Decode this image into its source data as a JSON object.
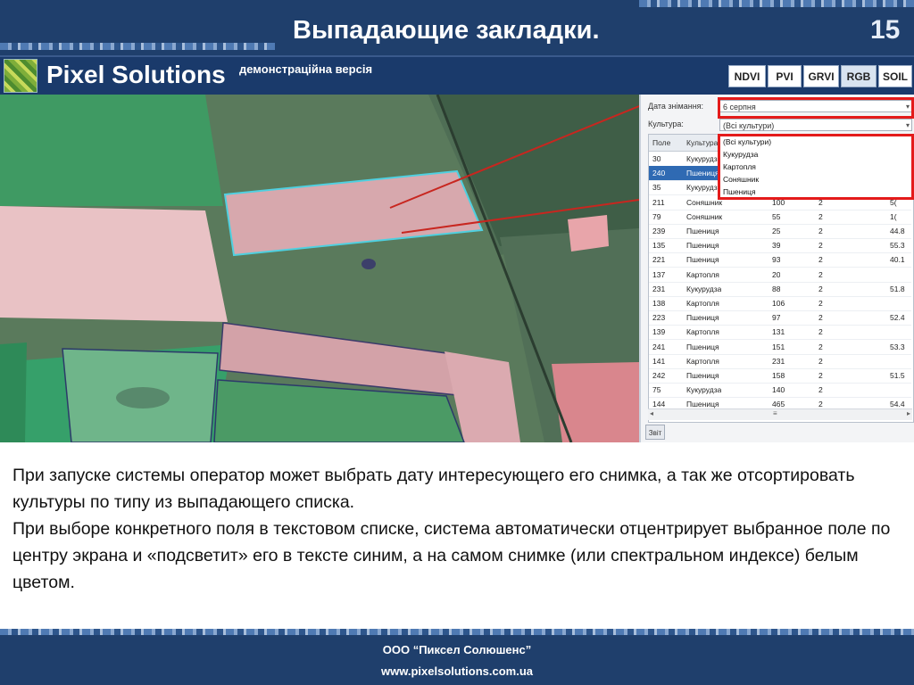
{
  "slide": {
    "title": "Выпадающие закладки.",
    "number": "15"
  },
  "app": {
    "name": "Pixel Solutions",
    "version": "демонстраційна версія",
    "tabs": [
      {
        "label": "NDVI",
        "active": false
      },
      {
        "label": "PVI",
        "active": false
      },
      {
        "label": "GRVI",
        "active": false
      },
      {
        "label": "RGB",
        "active": true
      },
      {
        "label": "SOIL",
        "active": false
      }
    ]
  },
  "panel": {
    "date_label": "Дата знімання:",
    "date_value": "6 серпня",
    "culture_label": "Культура:",
    "culture_value": "(Всі культури)",
    "columns": [
      "Поле",
      "Культура"
    ],
    "dropdown_options": [
      "(Всі культури)",
      "Кукурудза",
      "Картопля",
      "Соняшник",
      "Пшениця"
    ],
    "rows": [
      {
        "field": "30",
        "crop": "Кукурудза",
        "area": "",
        "n": "",
        "v": ""
      },
      {
        "field": "240",
        "crop": "Пшениця",
        "area": "",
        "n": "",
        "v": "",
        "selected": true
      },
      {
        "field": "35",
        "crop": "Кукурудза",
        "area": "",
        "n": "",
        "v": ""
      },
      {
        "field": "211",
        "crop": "Соняшник",
        "area": "100",
        "n": "2",
        "v": "5("
      },
      {
        "field": "79",
        "crop": "Соняшник",
        "area": "55",
        "n": "2",
        "v": "1("
      },
      {
        "field": "239",
        "crop": "Пшениця",
        "area": "25",
        "n": "2",
        "v": "44.8"
      },
      {
        "field": "135",
        "crop": "Пшениця",
        "area": "39",
        "n": "2",
        "v": "55.3"
      },
      {
        "field": "221",
        "crop": "Пшениця",
        "area": "93",
        "n": "2",
        "v": "40.1"
      },
      {
        "field": "137",
        "crop": "Картопля",
        "area": "20",
        "n": "2",
        "v": ""
      },
      {
        "field": "231",
        "crop": "Кукурудза",
        "area": "88",
        "n": "2",
        "v": "51.8"
      },
      {
        "field": "138",
        "crop": "Картопля",
        "area": "106",
        "n": "2",
        "v": ""
      },
      {
        "field": "223",
        "crop": "Пшениця",
        "area": "97",
        "n": "2",
        "v": "52.4"
      },
      {
        "field": "139",
        "crop": "Картопля",
        "area": "131",
        "n": "2",
        "v": ""
      },
      {
        "field": "241",
        "crop": "Пшениця",
        "area": "151",
        "n": "2",
        "v": "53.3"
      },
      {
        "field": "141",
        "crop": "Картопля",
        "area": "231",
        "n": "2",
        "v": ""
      },
      {
        "field": "242",
        "crop": "Пшениця",
        "area": "158",
        "n": "2",
        "v": "51.5"
      },
      {
        "field": "75",
        "crop": "Кукурудза",
        "area": "140",
        "n": "2",
        "v": ""
      },
      {
        "field": "144",
        "crop": "Пшениця",
        "area": "465",
        "n": "2",
        "v": "54.4"
      }
    ],
    "report_button": "Звіт"
  },
  "body_text": [
    "При запуске системы оператор может выбрать дату интересующего его снимка, а так же отсортировать культуры по типу из выпадающего списка.",
    "При выборе конкретного поля в текстовом списке, система автоматически отцентрирует выбранное поле по центру экрана и «подсветит» его в тексте синим, а на самом снимке (или спектральном индексе) белым цветом."
  ],
  "footer": {
    "company": "ООО “Пиксел Солюшенс”",
    "url": "www.pixelsolutions.com.ua"
  },
  "colors": {
    "header_bg": "#1f3f6c",
    "highlight_red": "#e41b1b",
    "selected_row": "#2f6ab3"
  }
}
